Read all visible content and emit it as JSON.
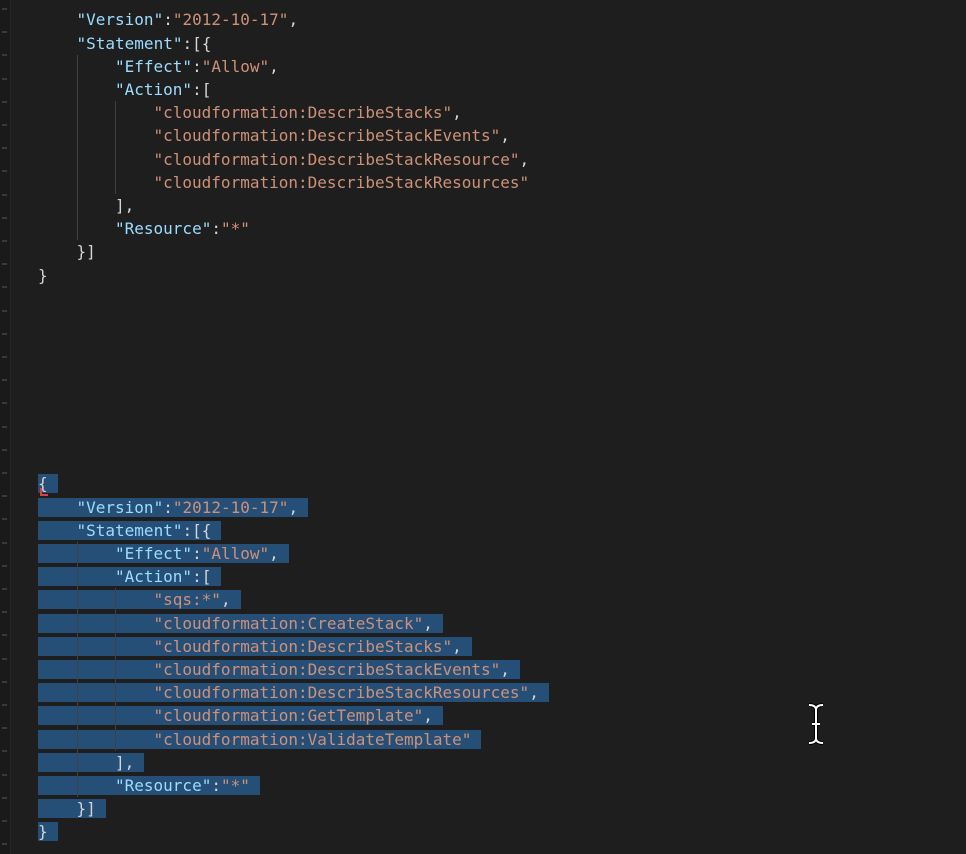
{
  "top_block": {
    "lines": [
      {
        "indent": 1,
        "tokens": [
          {
            "t": "k",
            "v": "\"Version\""
          },
          {
            "t": "p",
            "v": ":"
          },
          {
            "t": "s",
            "v": "\"2012-10-17\""
          },
          {
            "t": "p",
            "v": ","
          }
        ]
      },
      {
        "indent": 1,
        "tokens": [
          {
            "t": "k",
            "v": "\"Statement\""
          },
          {
            "t": "p",
            "v": ":[{"
          }
        ]
      },
      {
        "indent": 2,
        "tokens": [
          {
            "t": "k",
            "v": "\"Effect\""
          },
          {
            "t": "p",
            "v": ":"
          },
          {
            "t": "s",
            "v": "\"Allow\""
          },
          {
            "t": "p",
            "v": ","
          }
        ]
      },
      {
        "indent": 2,
        "tokens": [
          {
            "t": "k",
            "v": "\"Action\""
          },
          {
            "t": "p",
            "v": ":["
          }
        ]
      },
      {
        "indent": 3,
        "tokens": [
          {
            "t": "s",
            "v": "\"cloudformation:DescribeStacks\""
          },
          {
            "t": "p",
            "v": ","
          }
        ]
      },
      {
        "indent": 3,
        "tokens": [
          {
            "t": "s",
            "v": "\"cloudformation:DescribeStackEvents\""
          },
          {
            "t": "p",
            "v": ","
          }
        ]
      },
      {
        "indent": 3,
        "tokens": [
          {
            "t": "s",
            "v": "\"cloudformation:DescribeStackResource\""
          },
          {
            "t": "p",
            "v": ","
          }
        ]
      },
      {
        "indent": 3,
        "tokens": [
          {
            "t": "s",
            "v": "\"cloudformation:DescribeStackResources\""
          }
        ]
      },
      {
        "indent": 2,
        "tokens": [
          {
            "t": "p",
            "v": "],"
          }
        ]
      },
      {
        "indent": 2,
        "tokens": [
          {
            "t": "k",
            "v": "\"Resource\""
          },
          {
            "t": "p",
            "v": ":"
          },
          {
            "t": "s",
            "v": "\"*\""
          }
        ]
      },
      {
        "indent": 1,
        "tokens": [
          {
            "t": "p",
            "v": "}]"
          }
        ]
      },
      {
        "indent": 0,
        "tokens": [
          {
            "t": "p",
            "v": "}"
          }
        ]
      }
    ]
  },
  "bottom_block": {
    "selected": true,
    "lines": [
      {
        "indent": 0,
        "tokens": [
          {
            "t": "p",
            "v": "{"
          }
        ]
      },
      {
        "indent": 1,
        "tokens": [
          {
            "t": "k",
            "v": "\"Version\""
          },
          {
            "t": "p",
            "v": ":"
          },
          {
            "t": "s",
            "v": "\"2012-10-17\""
          },
          {
            "t": "p",
            "v": ","
          }
        ]
      },
      {
        "indent": 1,
        "tokens": [
          {
            "t": "k",
            "v": "\"Statement\""
          },
          {
            "t": "p",
            "v": ":[{"
          }
        ]
      },
      {
        "indent": 2,
        "tokens": [
          {
            "t": "k",
            "v": "\"Effect\""
          },
          {
            "t": "p",
            "v": ":"
          },
          {
            "t": "s",
            "v": "\"Allow\""
          },
          {
            "t": "p",
            "v": ","
          }
        ]
      },
      {
        "indent": 2,
        "tokens": [
          {
            "t": "k",
            "v": "\"Action\""
          },
          {
            "t": "p",
            "v": ":["
          }
        ]
      },
      {
        "indent": 3,
        "tokens": [
          {
            "t": "s",
            "v": "\"sqs:*\""
          },
          {
            "t": "p",
            "v": ","
          }
        ]
      },
      {
        "indent": 3,
        "tokens": [
          {
            "t": "s",
            "v": "\"cloudformation:CreateStack\""
          },
          {
            "t": "p",
            "v": ","
          }
        ]
      },
      {
        "indent": 3,
        "tokens": [
          {
            "t": "s",
            "v": "\"cloudformation:DescribeStacks\""
          },
          {
            "t": "p",
            "v": ","
          }
        ]
      },
      {
        "indent": 3,
        "tokens": [
          {
            "t": "s",
            "v": "\"cloudformation:DescribeStackEvents\""
          },
          {
            "t": "p",
            "v": ","
          }
        ]
      },
      {
        "indent": 3,
        "tokens": [
          {
            "t": "s",
            "v": "\"cloudformation:DescribeStackResources\""
          },
          {
            "t": "p",
            "v": ","
          }
        ]
      },
      {
        "indent": 3,
        "tokens": [
          {
            "t": "s",
            "v": "\"cloudformation:GetTemplate\""
          },
          {
            "t": "p",
            "v": ","
          }
        ]
      },
      {
        "indent": 3,
        "tokens": [
          {
            "t": "s",
            "v": "\"cloudformation:ValidateTemplate\""
          }
        ]
      },
      {
        "indent": 2,
        "tokens": [
          {
            "t": "p",
            "v": "],"
          }
        ]
      },
      {
        "indent": 2,
        "tokens": [
          {
            "t": "k",
            "v": "\"Resource\""
          },
          {
            "t": "p",
            "v": ":"
          },
          {
            "t": "s",
            "v": "\"*\""
          }
        ]
      },
      {
        "indent": 1,
        "tokens": [
          {
            "t": "p",
            "v": "}]"
          }
        ]
      },
      {
        "indent": 0,
        "tokens": [
          {
            "t": "p",
            "v": "}"
          }
        ]
      }
    ]
  },
  "colors": {
    "background": "#1e1e1e",
    "key": "#9cdcfe",
    "string": "#ce9178",
    "punctuation": "#d4d4d4",
    "selection": "#264f78"
  },
  "cursor": {
    "icon": "text-ibeam-cursor-icon"
  }
}
